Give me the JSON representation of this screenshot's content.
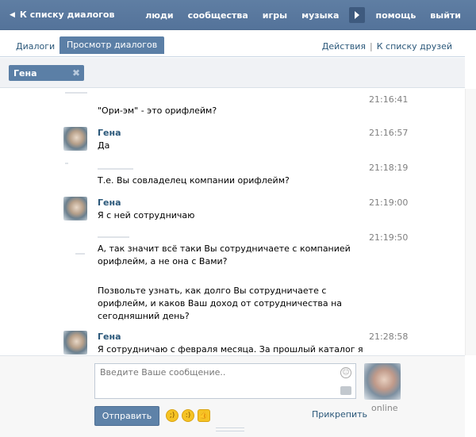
{
  "topbar": {
    "back_label": "К списку диалогов",
    "nav": [
      "люди",
      "сообщества",
      "игры",
      "музыка",
      "помощь",
      "выйти"
    ]
  },
  "tabs": {
    "dialogs": "Диалоги",
    "view": "Просмотр диалогов",
    "actions": "Действия",
    "separator": "|",
    "friends": "К списку друзей"
  },
  "filter": {
    "chip_label": "Гена"
  },
  "messages": [
    {
      "author": "",
      "time": "21:16:41",
      "text": "\"Ори-эм\" - это орифлейм?"
    },
    {
      "author": "Гена",
      "time": "21:16:57",
      "text": "Да"
    },
    {
      "author": "",
      "time": "21:18:19",
      "text": "Т.е. Вы совладелец компании орифлейм?"
    },
    {
      "author": "Гена",
      "time": "21:19:00",
      "text": "Я с ней сотрудничаю"
    },
    {
      "author": "",
      "time": "21:19:50",
      "text": "А, так значит всё таки Вы сотрудничаете с компанией орифлейм, а не она с Вами?",
      "text2": "Позвольте узнать, как долго Вы сотрудничаете с орифлейм, и каков Ваш доход от сотрудничества на сегодняшний день?"
    },
    {
      "author": "Гена",
      "time": "21:28:58",
      "text": "Я сотрудничаю с февраля месяца. За прошлый каталог я с супругой"
    }
  ],
  "compose": {
    "placeholder": "Введите Ваше сообщение..",
    "send_label": "Отправить",
    "attach_label": "Прикрепить",
    "status": "online"
  },
  "colors": {
    "brand": "#5b7fa6",
    "link": "#2b587a"
  }
}
